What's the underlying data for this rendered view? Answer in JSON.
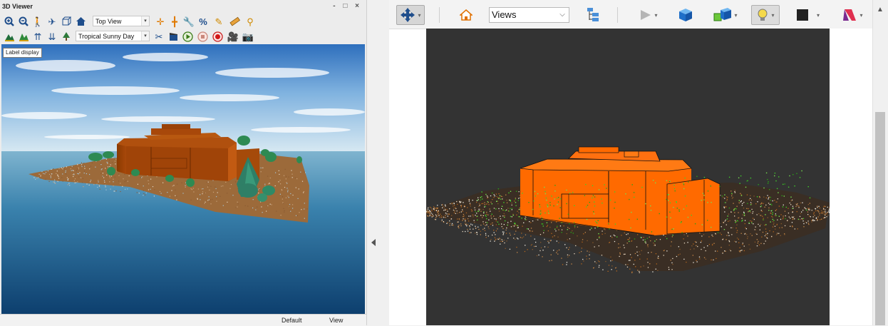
{
  "viewer": {
    "title": "3D Viewer",
    "window_controls": "- □ ×",
    "toolbar1": {
      "icons": [
        "zoom-in-icon",
        "zoom-out-icon",
        "walk-icon",
        "fly-icon",
        "cube-view-icon",
        "home-icon"
      ],
      "view_combo": "Top View",
      "tool_icons": [
        "crosshair-icon",
        "move-cross-icon",
        "wrench-icon",
        "percent-tool-icon",
        "pencil-icon",
        "ruler-icon",
        "magic-wand-icon"
      ]
    },
    "toolbar2": {
      "icons": [
        "terrain-icon",
        "mountain-icon",
        "scale-up-icon",
        "scale-down-icon",
        "tree-icon"
      ],
      "environment_combo": "Tropical Sunny Day",
      "tool_icons": [
        "scissors-icon",
        "clapper-icon",
        "play-icon",
        "stop-icon",
        "record-icon",
        "video-camera-icon",
        "camera-icon"
      ]
    },
    "tooltip": "Label display",
    "status": {
      "left": "Default",
      "right": "View"
    }
  },
  "right_toolbar": {
    "views_combo": "Views"
  },
  "colors": {
    "building": "#ff6a00",
    "ground": "#b5651d",
    "viewport_bg": "#333333"
  }
}
